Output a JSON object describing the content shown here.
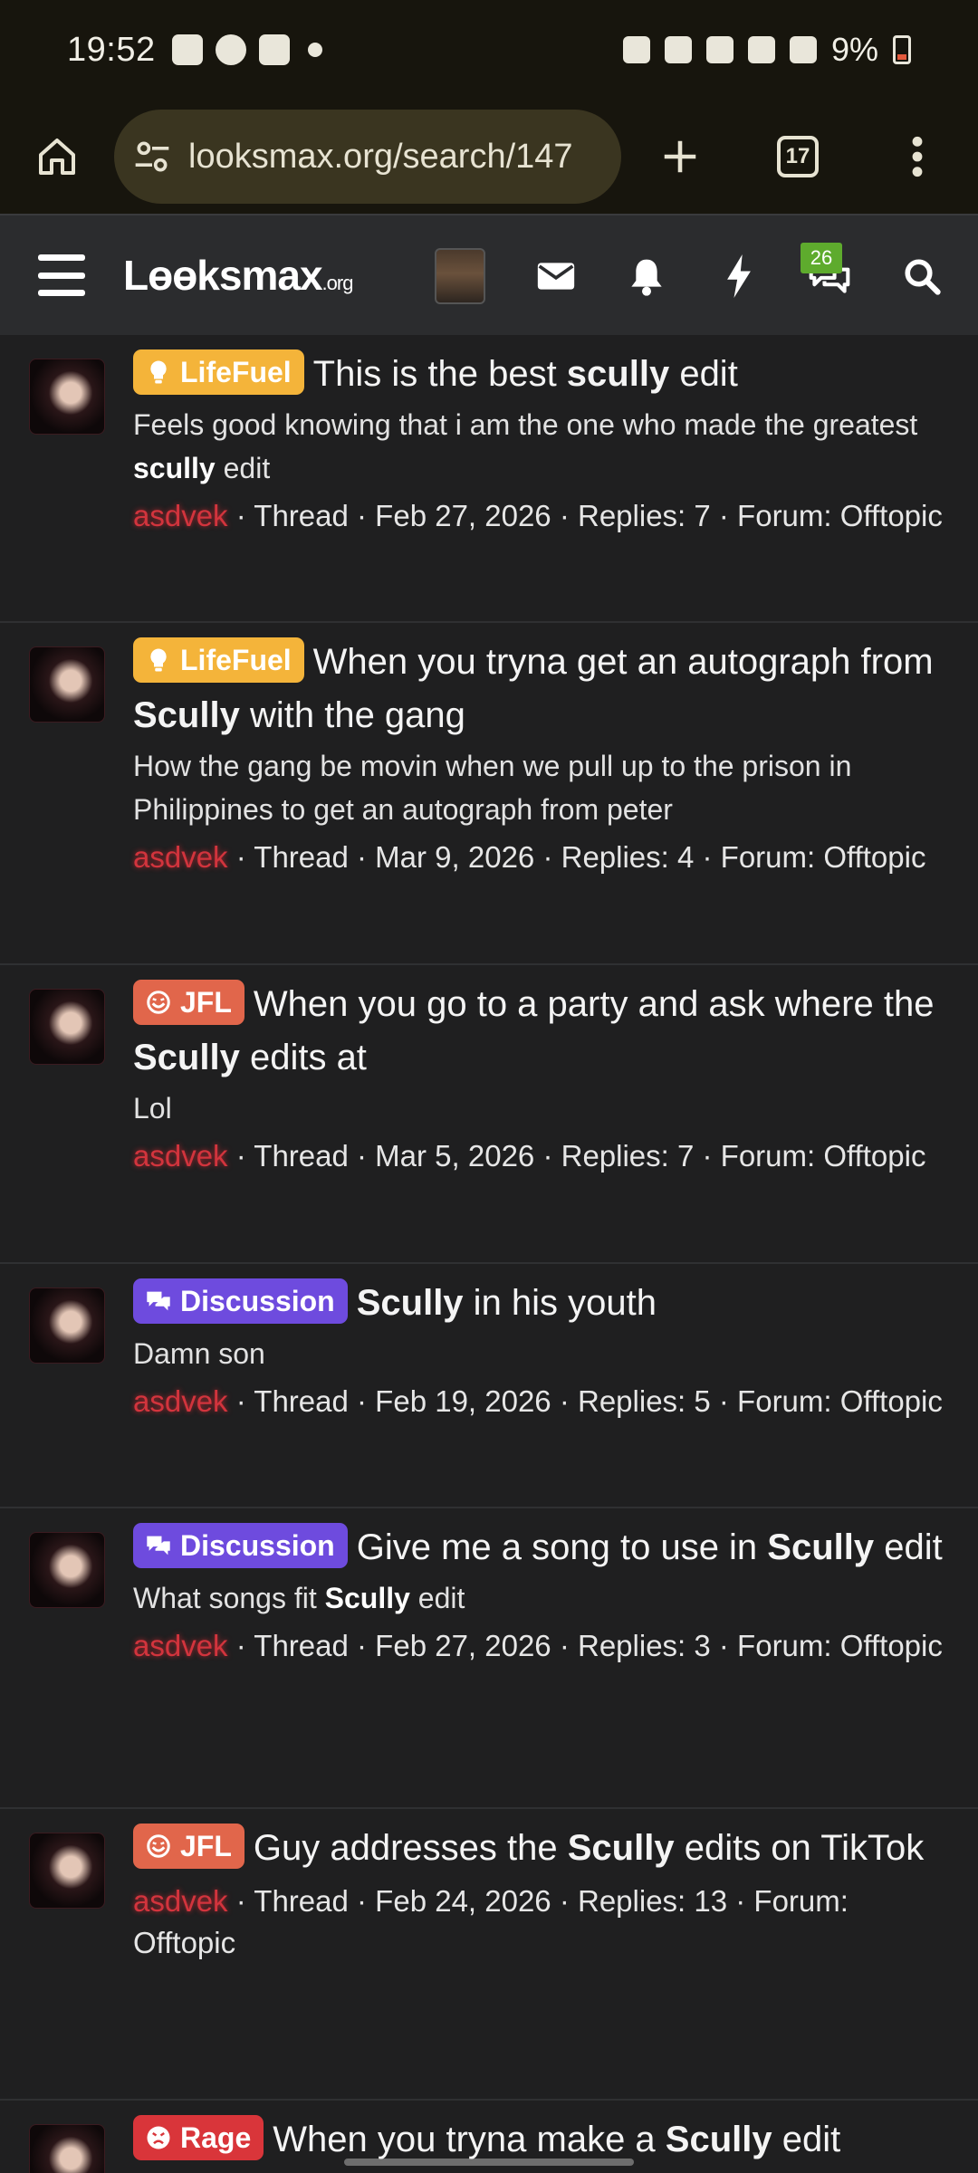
{
  "status_bar": {
    "time": "19:52",
    "battery": "9%"
  },
  "browser": {
    "url": "looksmax.org/search/147",
    "tab_count": "17"
  },
  "site_header": {
    "logo_main": "Lɵɵksmax",
    "logo_suffix": ".org",
    "chat_badge": "26"
  },
  "results": [
    {
      "prefix": "LifeFuel",
      "prefix_type": "lifefuel",
      "title_parts": [
        "This is the best ",
        "scully",
        " edit"
      ],
      "snippet_parts": [
        "Feels good knowing that i am the one who made the greatest ",
        "scully",
        " edit"
      ],
      "user": "asdvek",
      "meta": " · Thread · Feb 27, 2026 · Replies: 7 · Forum: Offtopic"
    },
    {
      "prefix": "LifeFuel",
      "prefix_type": "lifefuel",
      "title_parts": [
        "When you tryna get an autograph from ",
        "Scully",
        " with the gang"
      ],
      "snippet_parts": [
        "How the gang be movin when we pull up to the prison in Philippines to get an autograph from peter",
        "",
        ""
      ],
      "user": "asdvek",
      "meta": " · Thread · Mar 9, 2026 · Replies: 4 · Forum: Offtopic"
    },
    {
      "prefix": "JFL",
      "prefix_type": "jfl",
      "title_parts": [
        "When you go to a party and ask where the ",
        "Scully",
        " edits at"
      ],
      "snippet_parts": [
        "Lol",
        "",
        ""
      ],
      "user": "asdvek",
      "meta": " · Thread · Mar 5, 2026 · Replies: 7 · Forum: Offtopic"
    },
    {
      "prefix": "Discussion",
      "prefix_type": "discussion",
      "title_parts": [
        "",
        "Scully",
        " in his youth"
      ],
      "snippet_parts": [
        "Damn son",
        "",
        ""
      ],
      "user": "asdvek",
      "meta": " · Thread · Feb 19, 2026 · Replies: 5 · Forum: Offtopic"
    },
    {
      "prefix": "Discussion",
      "prefix_type": "discussion",
      "title_parts": [
        "Give me a song to use in ",
        "Scully",
        " edit"
      ],
      "snippet_parts": [
        "What songs fit ",
        "Scully",
        " edit"
      ],
      "user": "asdvek",
      "meta": " · Thread · Feb 27, 2026 · Replies: 3 · Forum: Offtopic"
    },
    {
      "prefix": "JFL",
      "prefix_type": "jfl",
      "title_parts": [
        "Guy addresses the ",
        "Scully",
        " edits on TikTok"
      ],
      "snippet_parts": [
        "",
        "",
        ""
      ],
      "user": "asdvek",
      "meta": " · Thread · Feb 24, 2026 · Replies: 13 · Forum: Offtopic"
    },
    {
      "prefix": "Rage",
      "prefix_type": "rage",
      "title_parts": [
        "When you tryna make a ",
        "Scully",
        " edit"
      ],
      "snippet_parts": [
        "",
        "",
        ""
      ],
      "user": "",
      "meta": ""
    }
  ]
}
